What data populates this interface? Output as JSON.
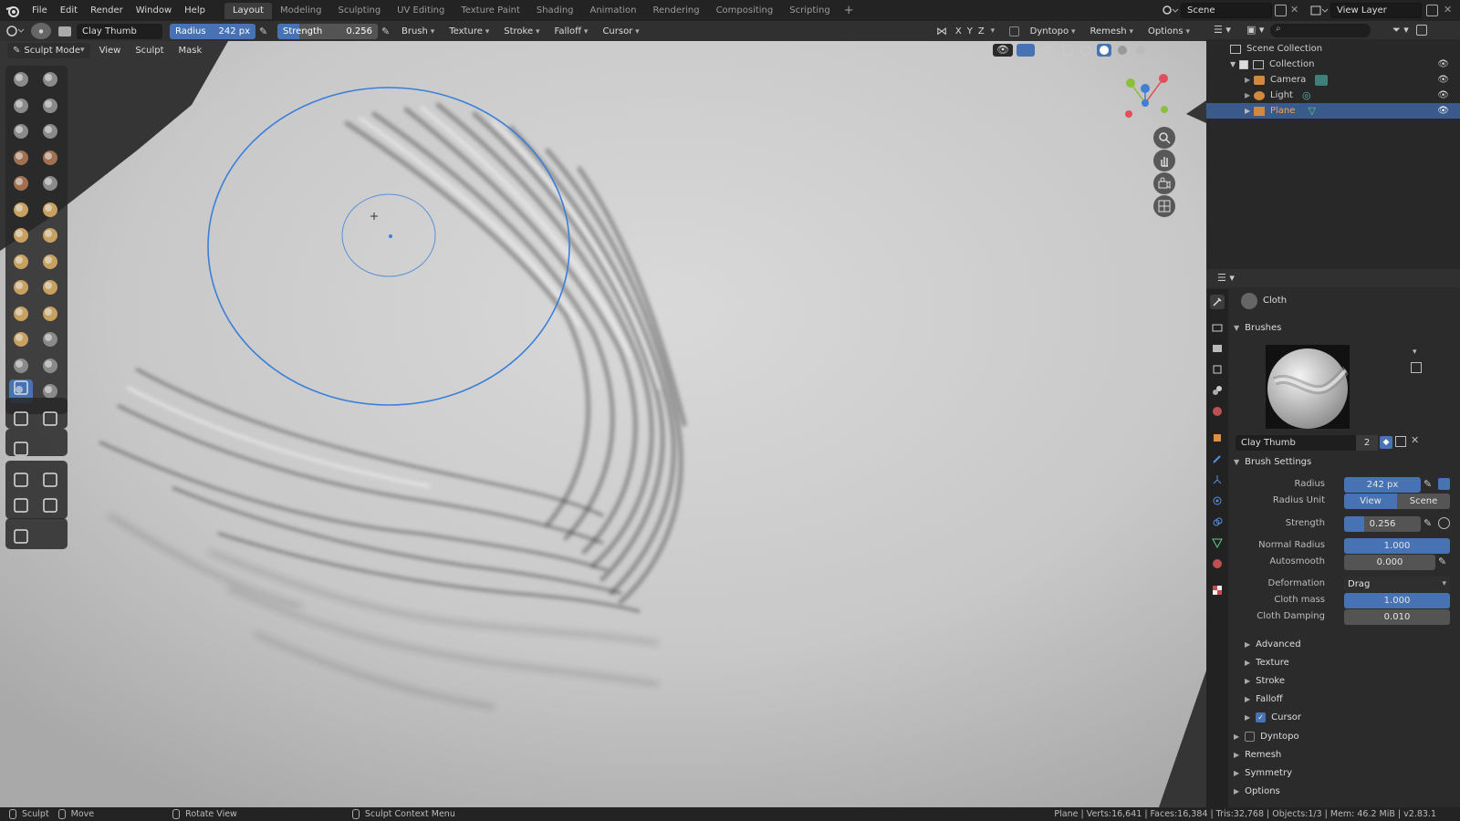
{
  "menus": [
    "File",
    "Edit",
    "Render",
    "Window",
    "Help"
  ],
  "workspaces": [
    "Layout",
    "Modeling",
    "Sculpting",
    "UV Editing",
    "Texture Paint",
    "Shading",
    "Animation",
    "Rendering",
    "Compositing",
    "Scripting"
  ],
  "active_workspace": "Layout",
  "scene_name": "Scene",
  "view_layer": "View Layer",
  "tool_header": {
    "brush_name": "Clay Thumb",
    "radius_label": "Radius",
    "radius_value": "242 px",
    "strength_label": "Strength",
    "strength_value": "0.256",
    "menus": [
      "Brush",
      "Texture",
      "Stroke",
      "Falloff",
      "Cursor"
    ],
    "axes": [
      "X",
      "Y",
      "Z"
    ],
    "dyntopo": "Dyntopo",
    "remesh": "Remesh",
    "options": "Options"
  },
  "viewport_header": {
    "mode": "Sculpt Mode",
    "menus": [
      "View",
      "Sculpt",
      "Mask"
    ]
  },
  "outliner": {
    "root": "Scene Collection",
    "collection": "Collection",
    "items": [
      "Camera",
      "Light",
      "Plane"
    ],
    "selected": "Plane"
  },
  "properties": {
    "object_label": "Cloth",
    "brushes_header": "Brushes",
    "brush_name": "Clay Thumb",
    "brush_users": "2",
    "brush_settings_header": "Brush Settings",
    "fields": {
      "radius_label": "Radius",
      "radius_value": "242 px",
      "radius_unit_label": "Radius Unit",
      "radius_unit_view": "View",
      "radius_unit_scene": "Scene",
      "strength_label": "Strength",
      "strength_value": "0.256",
      "normal_radius_label": "Normal Radius",
      "normal_radius_value": "1.000",
      "autosmooth_label": "Autosmooth",
      "autosmooth_value": "0.000",
      "deformation_label": "Deformation",
      "deformation_value": "Drag",
      "cloth_mass_label": "Cloth mass",
      "cloth_mass_value": "1.000",
      "cloth_damping_label": "Cloth Damping",
      "cloth_damping_value": "0.010"
    },
    "sub_sections": [
      "Advanced",
      "Texture",
      "Stroke",
      "Falloff",
      "Cursor"
    ],
    "cursor_checked": true,
    "sections": [
      "Dyntopo",
      "Remesh",
      "Symmetry",
      "Options"
    ]
  },
  "statusbar": {
    "left": [
      "Sculpt",
      "Move",
      "Rotate View",
      "Sculpt Context Menu"
    ],
    "stats": "Plane | Verts:16,641 | Faces:16,384 | Tris:32,768 | Objects:1/3 | Mem: 46.2 MiB | v2.83.1"
  },
  "colors": {
    "accent": "#4772b3",
    "brush_cursor": "#3a7fd9",
    "axis_x": "#e0505a",
    "axis_y": "#8cbf3a",
    "axis_z": "#3f7fd6"
  },
  "fill_levels": {
    "strength": 0.256,
    "normal_radius": 1.0,
    "cloth_mass": 1.0
  }
}
